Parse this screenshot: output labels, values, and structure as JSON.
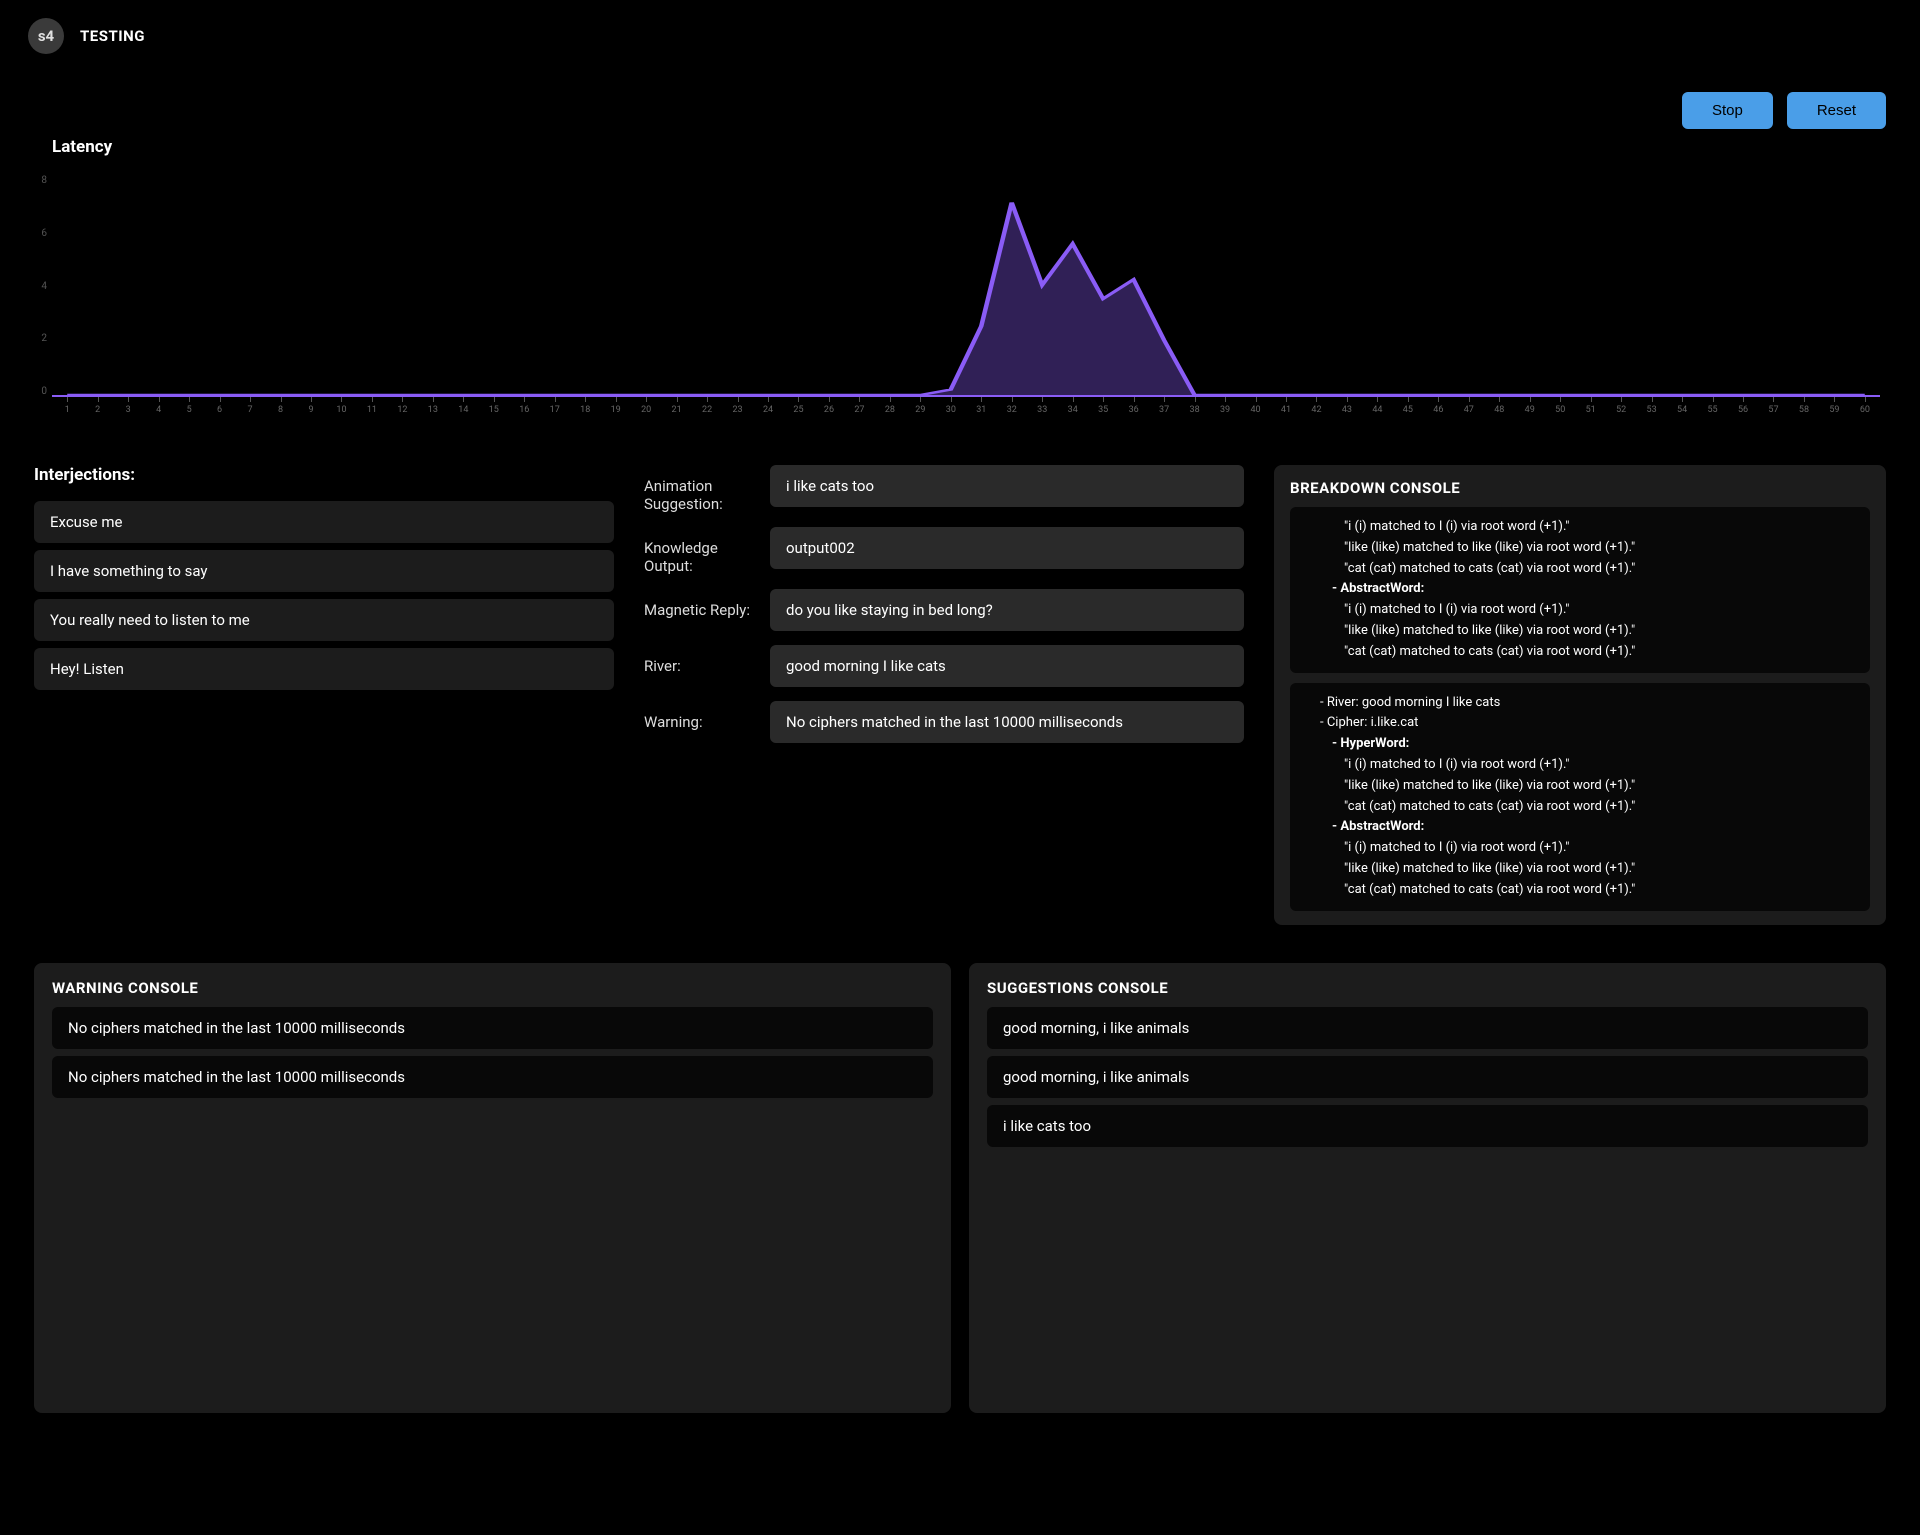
{
  "header": {
    "logo_text": "s4",
    "title": "TESTING"
  },
  "toolbar": {
    "stop_label": "Stop",
    "reset_label": "Reset"
  },
  "chart": {
    "title": "Latency"
  },
  "chart_data": {
    "type": "area",
    "title": "Latency",
    "xlabel": "",
    "ylabel": "",
    "ylim": [
      0,
      8
    ],
    "x_ticks": [
      1,
      2,
      3,
      4,
      5,
      6,
      7,
      8,
      9,
      10,
      11,
      12,
      13,
      14,
      15,
      16,
      17,
      18,
      19,
      20,
      21,
      22,
      23,
      24,
      25,
      26,
      27,
      28,
      29,
      30,
      31,
      32,
      33,
      34,
      35,
      36,
      37,
      38,
      39,
      40,
      41,
      42,
      43,
      44,
      45,
      46,
      47,
      48,
      49,
      50,
      51,
      52,
      53,
      54,
      55,
      56,
      57,
      58,
      59,
      60
    ],
    "y_ticks": [
      0,
      2,
      4,
      6,
      8
    ],
    "x": [
      1,
      2,
      3,
      4,
      5,
      6,
      7,
      8,
      9,
      10,
      11,
      12,
      13,
      14,
      15,
      16,
      17,
      18,
      19,
      20,
      21,
      22,
      23,
      24,
      25,
      26,
      27,
      28,
      29,
      30,
      31,
      32,
      33,
      34,
      35,
      36,
      37,
      38,
      39,
      40,
      41,
      42,
      43,
      44,
      45,
      46,
      47,
      48,
      49,
      50,
      51,
      52,
      53,
      54,
      55,
      56,
      57,
      58,
      59,
      60
    ],
    "values": [
      0,
      0,
      0,
      0,
      0,
      0,
      0,
      0,
      0,
      0,
      0,
      0,
      0,
      0,
      0,
      0,
      0,
      0,
      0,
      0,
      0,
      0,
      0,
      0,
      0,
      0,
      0,
      0,
      0,
      0.2,
      2.5,
      7.0,
      4.0,
      5.5,
      3.5,
      4.2,
      2.0,
      0,
      0,
      0,
      0,
      0,
      0,
      0,
      0,
      0,
      0,
      0,
      0,
      0,
      0,
      0,
      0,
      0,
      0,
      0,
      0,
      0,
      0,
      0
    ],
    "color": "#8a5cf6"
  },
  "interjections": {
    "title": "Interjections:",
    "items": [
      "Excuse me",
      "I have something to say",
      "You really need to listen to me",
      "Hey! Listen"
    ]
  },
  "kv": {
    "animation_label": "Animation Suggestion:",
    "animation_value": "i like cats too",
    "knowledge_label": "Knowledge Output:",
    "knowledge_value": "output002",
    "magnetic_label": "Magnetic Reply:",
    "magnetic_value": "do you like staying in bed long?",
    "river_label": "River:",
    "river_value": "good morning I like cats",
    "warning_label": "Warning:",
    "warning_value": "No ciphers matched in the last 10000 milliseconds"
  },
  "breakdown": {
    "title": "BREAKDOWN CONSOLE",
    "blocks": [
      {
        "lines": [
          {
            "text": "\"i (i) matched to I (i) via root word (+1).\"",
            "indent": 3,
            "bold": false
          },
          {
            "text": "\"like (like) matched to like (like) via root word (+1).\"",
            "indent": 3,
            "bold": false
          },
          {
            "text": "\"cat (cat) matched to cats (cat) via root word (+1).\"",
            "indent": 3,
            "bold": false
          },
          {
            "text": "- AbstractWord:",
            "indent": 2,
            "bold": true
          },
          {
            "text": "\"i (i) matched to I (i) via root word (+1).\"",
            "indent": 3,
            "bold": false
          },
          {
            "text": "\"like (like) matched to like (like) via root word (+1).\"",
            "indent": 3,
            "bold": false
          },
          {
            "text": "\"cat (cat) matched to cats (cat) via root word (+1).\"",
            "indent": 3,
            "bold": false
          }
        ]
      },
      {
        "lines": [
          {
            "text": "- River: good morning I like cats",
            "indent": 1,
            "bold": false
          },
          {
            "text": "- Cipher: i.like.cat",
            "indent": 1,
            "bold": false
          },
          {
            "text": "- HyperWord:",
            "indent": 2,
            "bold": true
          },
          {
            "text": "\"i (i) matched to I (i) via root word (+1).\"",
            "indent": 3,
            "bold": false
          },
          {
            "text": "\"like (like) matched to like (like) via root word (+1).\"",
            "indent": 3,
            "bold": false
          },
          {
            "text": "\"cat (cat) matched to cats (cat) via root word (+1).\"",
            "indent": 3,
            "bold": false
          },
          {
            "text": "- AbstractWord:",
            "indent": 2,
            "bold": true
          },
          {
            "text": "\"i (i) matched to I (i) via root word (+1).\"",
            "indent": 3,
            "bold": false
          },
          {
            "text": "\"like (like) matched to like (like) via root word (+1).\"",
            "indent": 3,
            "bold": false
          },
          {
            "text": "\"cat (cat) matched to cats (cat) via root word (+1).\"",
            "indent": 3,
            "bold": false
          }
        ]
      }
    ]
  },
  "warning_console": {
    "title": "WARNING CONSOLE",
    "items": [
      "No ciphers matched in the last 10000 milliseconds",
      "No ciphers matched in the last 10000 milliseconds"
    ]
  },
  "suggestions_console": {
    "title": "SUGGESTIONS CONSOLE",
    "items": [
      "good morning, i like animals",
      "good morning, i like animals",
      "i like cats too"
    ]
  }
}
